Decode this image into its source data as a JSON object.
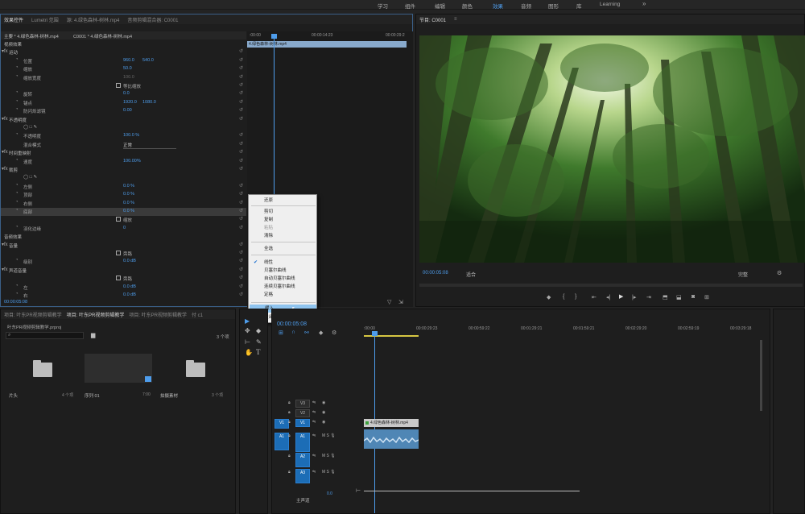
{
  "workspaces": [
    "学习",
    "组件",
    "编辑",
    "颜色",
    "效果",
    "音频",
    "图形",
    "库",
    "Learning"
  ],
  "active_workspace": "效果",
  "ec": {
    "tabs": [
      "效果控件",
      "Lumetri 范围",
      "源: 4.绿色森林-树林.mp4",
      "音频剪辑混合器: C0001"
    ],
    "src": "主要 * 4.绿色森林-树林.mp4",
    "seq": "C0001 * 4.绿色森林-树林.mp4",
    "t0": ":00:00",
    "t1": "00:00:14:23",
    "t2": "00:00:29:2",
    "clip": "4.绿色森林-树林.mp4",
    "time": "00:00:05:08",
    "rows": [
      {
        "t": "视频效果",
        "type": "h"
      },
      {
        "t": "运动",
        "type": "s"
      },
      {
        "t": "位置",
        "v": "960.0",
        "v2": "540.0"
      },
      {
        "t": "缩放",
        "v": "50.0"
      },
      {
        "t": "缩放宽度",
        "v": "100.0",
        "dim": true
      },
      {
        "t": "等比缩放",
        "type": "cb"
      },
      {
        "t": "旋转",
        "v": "0.0"
      },
      {
        "t": "锚点",
        "v": "1920.0",
        "v2": "1080.0"
      },
      {
        "t": "防闪烁滤镜",
        "v": "0.00"
      },
      {
        "t": "不透明度",
        "type": "s"
      },
      {
        "t": "",
        "type": "mask"
      },
      {
        "t": "不透明度",
        "v": "100.0 %"
      },
      {
        "t": "混合模式",
        "v": "正常",
        "type": "dd"
      },
      {
        "t": "时间重映射",
        "type": "s"
      },
      {
        "t": "速度",
        "v": "100.00%"
      },
      {
        "t": "裁剪",
        "type": "s"
      },
      {
        "t": "",
        "type": "mask"
      },
      {
        "t": "左侧",
        "v": "0.0 %"
      },
      {
        "t": "顶部",
        "v": "0.0 %"
      },
      {
        "t": "右侧",
        "v": "0.0 %"
      },
      {
        "t": "底部",
        "v": "0.0 %",
        "hl": true
      },
      {
        "t": "缩放",
        "type": "cb"
      },
      {
        "t": "羽化边缘",
        "v": "0"
      },
      {
        "t": "音频效果",
        "type": "h"
      },
      {
        "t": "音量",
        "type": "s"
      },
      {
        "t": "旁路",
        "type": "cb"
      },
      {
        "t": "级别",
        "v": "0.0 dB"
      },
      {
        "t": "声道音量",
        "type": "s"
      },
      {
        "t": "旁路",
        "type": "cb"
      },
      {
        "t": "左",
        "v": "0.0 dB"
      },
      {
        "t": "右",
        "v": "0.0 dB"
      }
    ]
  },
  "menu": [
    "还原",
    "剪切",
    "复制",
    "粘贴",
    "清除",
    "全选",
    "线性",
    "贝塞尔曲线",
    "自动贝塞尔曲线",
    "连续贝塞尔曲线",
    "定格",
    "缓入",
    "缓出"
  ],
  "program": {
    "title": "节目: C0001",
    "time": "00:00:05:08",
    "fit": "适合",
    "quality": "完整"
  },
  "project": {
    "tabs": [
      "项目: 叶东PR视频剪辑教学",
      "项目: 叶东PR视频剪辑教学",
      "项目: 叶东PR视频剪辑教学",
      "付 c1"
    ],
    "file": "叶东PR视频剪辑教学.prproj",
    "count": "3 个项",
    "items": [
      {
        "name": "片头",
        "meta": "4 个项"
      },
      {
        "name": "序列 01",
        "meta": "7:00"
      },
      {
        "name": "拍摄素材",
        "meta": "3 个项"
      }
    ]
  },
  "timeline": {
    "time": "00:00:05:08",
    "ruler": [
      ":00:00",
      "00:00:29:23",
      "00:00:59:22",
      "00:01:29:21",
      "00:01:59:21",
      "00:02:29:20",
      "00:02:59:19",
      "00:03:29:18"
    ],
    "tracks": [
      "V3",
      "V2",
      "V1",
      "A1",
      "A2",
      "A3"
    ],
    "src_v": "V1",
    "src_a": "A1",
    "clip_v": "4.绿色森林-树林.mp4",
    "master": "主声道",
    "master_val": "0.0"
  },
  "colors": {
    "accent": "#4e9dec",
    "track_on": "#1c6db6",
    "clip_v": "#c9c9c9",
    "clip_a": "#4f86b5"
  }
}
